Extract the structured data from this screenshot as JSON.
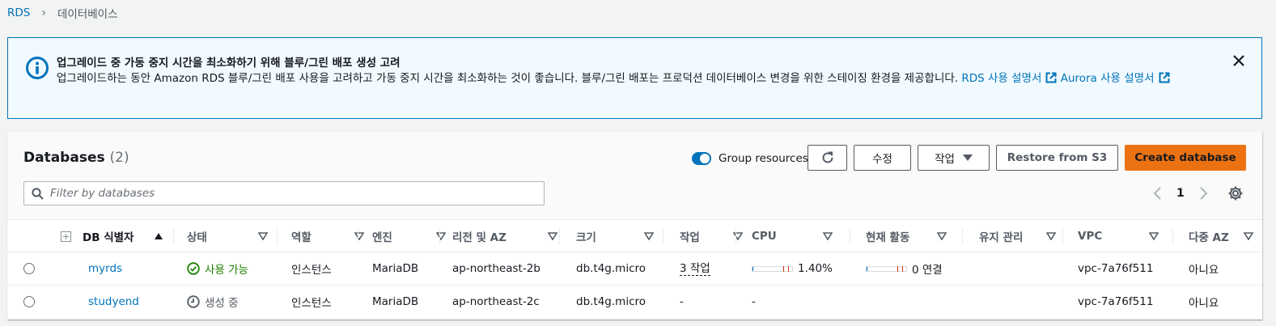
{
  "breadcrumb": {
    "root": "RDS",
    "current": "데이터베이스"
  },
  "alert": {
    "title": "업그레이드 중 가동 중지 시간을 최소화하기 위해 블루/그린 배포 생성 고려",
    "body": "업그레이드하는 동안 Amazon RDS 블루/그린 배포 사용을 고려하고 가동 중지 시간을 최소화하는 것이 좋습니다. 블루/그린 배포는 프로덕션 데이터베이스 변경을 위한 스테이징 환경을 제공합니다.",
    "link1": "RDS 사용 설명서",
    "link2": "Aurora 사용 설명서",
    "color": "#0073bb"
  },
  "panel": {
    "title": "Databases",
    "count": "(2)",
    "group_label": "Group resources",
    "modify_label": "수정",
    "action_label": "작업",
    "restore_label": "Restore from S3",
    "create_label": "Create database",
    "search_placeholder": "Filter by databases",
    "page": "1"
  },
  "columns": [
    "DB 식별자",
    "상태",
    "역할",
    "엔진",
    "리전 및 AZ",
    "크기",
    "작업",
    "CPU",
    "현재 활동",
    "유지 관리",
    "VPC",
    "다중 AZ"
  ],
  "rows": [
    {
      "id": "myrds",
      "status": "사용 가능",
      "role": "인스턴스",
      "engine": "MariaDB",
      "az": "ap-northeast-2b",
      "size": "db.t4g.micro",
      "actions": "3 작업",
      "cpu": "1.40%",
      "cpu_fraction": 0.014,
      "activity": "0 연결",
      "activity_fraction": 0,
      "maintenance": "",
      "vpc": "vpc-7a76f511",
      "multi_az": "아니요"
    },
    {
      "id": "studyend",
      "status": "생성 중",
      "role": "인스턴스",
      "engine": "MariaDB",
      "az": "ap-northeast-2c",
      "size": "db.t4g.micro",
      "actions": "-",
      "cpu": "-",
      "activity": "",
      "maintenance": "",
      "vpc": "vpc-7a76f511",
      "multi_az": "아니요"
    }
  ]
}
